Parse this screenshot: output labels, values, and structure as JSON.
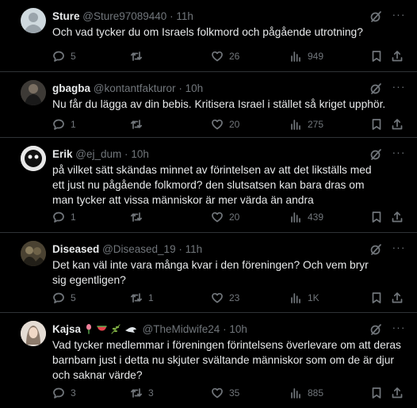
{
  "tweets": [
    {
      "name": "Sture",
      "handle": "@Sture97089440",
      "dot": "·",
      "time": "11h",
      "text": "Och vad tycker du om Israels folkmord och pågående utrotning?",
      "replies": "5",
      "retweets": "",
      "likes": "26",
      "views": "949"
    },
    {
      "name": "gbagba",
      "handle": "@kontantfakturor",
      "dot": "·",
      "time": "10h",
      "text": "Nu får du lägga av din bebis. Kritisera Israel i stället så kriget upphör.",
      "replies": "1",
      "retweets": "",
      "likes": "20",
      "views": "275"
    },
    {
      "name": "Erik",
      "handle": "@ej_dum",
      "dot": "·",
      "time": "10h",
      "text": "på vilket sätt skändas minnet av förintelsen av att det likställs med ett just nu pågående folkmord? den slutsatsen kan bara dras om man tycker att vissa människor är mer värda än andra",
      "replies": "1",
      "retweets": "",
      "likes": "20",
      "views": "439"
    },
    {
      "name": "Diseased",
      "handle": "@Diseased_19",
      "dot": "·",
      "time": "11h",
      "text": "Det kan väl inte vara många kvar i den föreningen? Och vem bryr sig egentligen?",
      "replies": "5",
      "retweets": "1",
      "likes": "23",
      "views": "1K"
    },
    {
      "name": "Kajsa",
      "handle": "@TheMidwife24",
      "dot": "·",
      "time": "10h",
      "text": "Vad tycker medlemmar i föreningen förintelsens överlevare om att deras barnbarn just i detta nu skjuter svältande människor som om de är djur och saknar värde?",
      "replies": "3",
      "retweets": "3",
      "likes": "35",
      "views": "885"
    }
  ],
  "icons": {
    "reply": "reply-icon",
    "retweet": "retweet-icon",
    "like": "heart-icon",
    "views": "views-icon",
    "bookmark": "bookmark-icon",
    "share": "share-icon",
    "grok": "grok-icon",
    "more": "more-icon"
  },
  "colors": {
    "background": "#000000",
    "text": "#e7e9ea",
    "muted": "#71767b",
    "divider": "#2f3336"
  }
}
